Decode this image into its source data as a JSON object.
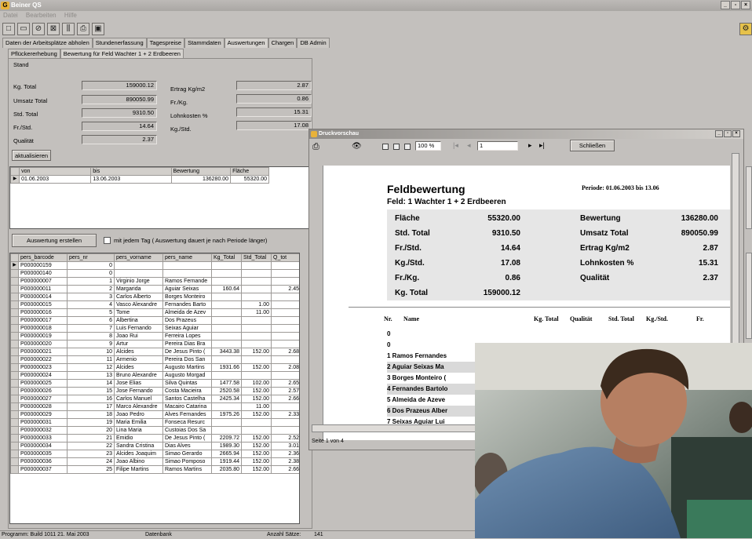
{
  "app": {
    "title": "Beiner QS"
  },
  "menu": [
    "Datei",
    "Bearbeiten",
    "Hilfe"
  ],
  "main_tabs": [
    "Daten der Arbeitsplätze abholen",
    "Stundenerfassung",
    "Tagespreise",
    "Stammdaten",
    "Auswertungen",
    "Chargen",
    "DB Admin"
  ],
  "sub_tabs": [
    "Pflückererhebung",
    "Bewertung für Feld Wachter 1 + 2 Erdbeeren"
  ],
  "stand": {
    "label": "Stand",
    "kg_total_label": "Kg. Total",
    "kg_total": "159000.12",
    "umsatz_label": "Umsatz Total",
    "umsatz": "890050.99",
    "std_label": "Std. Total",
    "std": "9310.50",
    "fr_std_label": "Fr./Std.",
    "fr_std": "14.64",
    "qual_label": "Qualität",
    "qual": "2.37",
    "ertrag_label": "Ertrag Kg/m2",
    "ertrag": "2.87",
    "fr_kg_label": "Fr./Kg.",
    "fr_kg": "0.86",
    "lohn_label": "Lohnkosten %",
    "lohn": "15.31",
    "kg_std_label": "Kg./Std.",
    "kg_std": "17.08",
    "refresh_label": "aktualisieren"
  },
  "period_grid": {
    "headers": [
      "von",
      "bis",
      "Bewertung",
      "Fläche"
    ],
    "rows": [
      [
        "01.06.2003",
        "13.06.2003",
        "136280.00",
        "55320.00"
      ]
    ]
  },
  "auswertung": {
    "button_label": "Auswertung erstellen",
    "checkbox_label": "mit jedem Tag ( Auswertung dauert je nach Periode länger)"
  },
  "pickers": {
    "headers": [
      "pers_barcode",
      "pers_nr",
      "pers_vorname",
      "pers_name",
      "Kg_Total",
      "Std_Total",
      "Q_tot"
    ],
    "rows": [
      [
        "P000000159",
        "0",
        "",
        "",
        "",
        "",
        ""
      ],
      [
        "P000000140",
        "0",
        "",
        "",
        "",
        "",
        ""
      ],
      [
        "P000000007",
        "1",
        "Virginio Jorge",
        "Ramos Fernande",
        "",
        "",
        ""
      ],
      [
        "P000000011",
        "2",
        "Margarida",
        "Aguiar Seixas",
        "160.64",
        "",
        "2.45"
      ],
      [
        "P000000014",
        "3",
        "Carlos Alberto",
        "Borges Monteiro",
        "",
        "",
        ""
      ],
      [
        "P000000015",
        "4",
        "Vasco Alexandre",
        "Fernandes Barto",
        "",
        "1.00",
        ""
      ],
      [
        "P000000016",
        "5",
        "Tome",
        "Almeida de Azev",
        "",
        "11.00",
        ""
      ],
      [
        "P000000017",
        "6",
        "Albertina",
        "Dos Prazeus",
        "",
        "",
        ""
      ],
      [
        "P000000018",
        "7",
        "Luis Fernando",
        "Seixas Aguiar",
        "",
        "",
        ""
      ],
      [
        "P000000019",
        "8",
        "Joao Rui",
        "Ferreira Lopes",
        "",
        "",
        ""
      ],
      [
        "P000000020",
        "9",
        "Artur",
        "Pereira Dias Bra",
        "",
        "",
        ""
      ],
      [
        "P000000021",
        "10",
        "Alcides",
        "De Jesus Pinto (",
        "3443.38",
        "152.00",
        "2.68"
      ],
      [
        "P000000022",
        "11",
        "Armenio",
        "Pereira Dos San",
        "",
        "",
        ""
      ],
      [
        "P000000023",
        "12",
        "Alcides",
        "Augusto Martins",
        "1931.66",
        "152.00",
        "2.08"
      ],
      [
        "P000000024",
        "13",
        "Bruno Alexandre",
        "Augusto Morgad",
        "",
        "",
        ""
      ],
      [
        "P000000025",
        "14",
        "Jose Elias",
        "Silva Quintas",
        "1477.58",
        "102.00",
        "2.65"
      ],
      [
        "P000000026",
        "15",
        "Jose Fernando",
        "Costa Macieira",
        "2520.58",
        "152.00",
        "2.57"
      ],
      [
        "P000000027",
        "16",
        "Carlos Manuel",
        "Santos Castelha",
        "2425.34",
        "152.00",
        "2.66"
      ],
      [
        "P000000028",
        "17",
        "Marco Alexandre",
        "Macairo Catarina",
        "",
        "11.00",
        ""
      ],
      [
        "P000000029",
        "18",
        "Joao Pedro",
        "Alves Fernandes",
        "1975.26",
        "152.00",
        "2.33"
      ],
      [
        "P000000031",
        "19",
        "Maria Emilia",
        "Fonseca Resurc",
        "",
        "",
        ""
      ],
      [
        "P000000032",
        "20",
        "Lina Maria",
        "Custoias Dos Sa",
        "",
        "",
        ""
      ],
      [
        "P000000033",
        "21",
        "Emidio",
        "De Jesus Pinto (",
        "2209.72",
        "152.00",
        "2.52"
      ],
      [
        "P000000034",
        "22",
        "Sandra Cristina",
        "Dias Alves",
        "1989.30",
        "152.00",
        "3.01"
      ],
      [
        "P000000035",
        "23",
        "Alcides Joaquim",
        "Simao Gerardo",
        "2665.94",
        "152.00",
        "2.36"
      ],
      [
        "P000000036",
        "24",
        "Joao Albino",
        "Simao Pomposo",
        "1919.44",
        "152.00",
        "2.38"
      ],
      [
        "P000000037",
        "25",
        "Filipe Martins",
        "Ramos Martins",
        "2035.80",
        "152.00",
        "2.66"
      ]
    ]
  },
  "preview": {
    "title": "Druckvorschau",
    "zoom": "100 %",
    "page": "1",
    "close_label": "Schließen",
    "status": "Seite 1 von 4"
  },
  "report": {
    "title": "Feldbewertung",
    "subtitle": "Feld: 1 Wachter 1 + 2 Erdbeeren",
    "period": "Periode: 01.06.2003 bis 13.06",
    "summary_left": [
      [
        "Fläche",
        "55320.00"
      ],
      [
        "Std. Total",
        "9310.50"
      ],
      [
        "Fr./Std.",
        "14.64"
      ],
      [
        "Kg./Std.",
        "17.08"
      ],
      [
        "Fr./Kg.",
        "0.86"
      ],
      [
        "Kg. Total",
        "159000.12"
      ]
    ],
    "summary_right": [
      [
        "Bewertung",
        "136280.00"
      ],
      [
        "Umsatz Total",
        "890050.99"
      ],
      [
        "Ertrag Kg/m2",
        "2.87"
      ],
      [
        "Lohnkosten %",
        "15.31"
      ],
      [
        "Qualität",
        "2.37"
      ]
    ],
    "columns": [
      "Nr.",
      "Name",
      "Kg. Total",
      "Qualität",
      "Std. Total",
      "Kg./Std.",
      "Fr."
    ],
    "rows": [
      "0",
      "0",
      "1 Ramos Fernandes",
      "2 Aguiar Seixas Ma",
      "3 Borges Monteiro (",
      "4 Fernandes Bartolo",
      "5 Almeida de Azeve",
      "6 Dos Prazeus Alber",
      "7 Seixas Aguiar Lui"
    ]
  },
  "statusbar": {
    "left": "Programm: Build 1011 21. Mai 2003",
    "db": "Datenbank",
    "count_label": "Anzahl Sätze:",
    "count": "141"
  }
}
